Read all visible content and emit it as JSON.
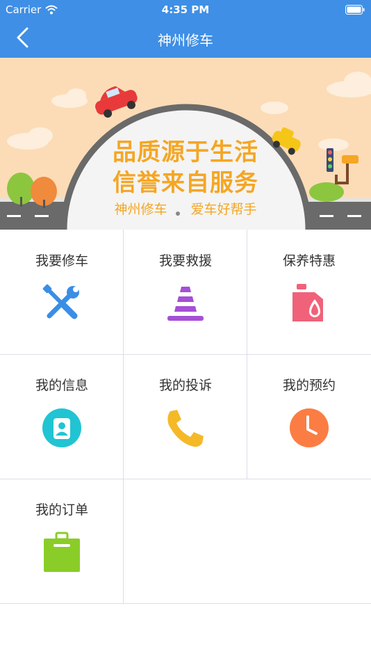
{
  "status_bar": {
    "carrier": "Carrier",
    "time": "4:35 PM"
  },
  "nav": {
    "title": "神州修车",
    "back_icon": "chevron-left-icon"
  },
  "banner": {
    "headline_1": "品质源于生活",
    "headline_2": "信誉来自服务",
    "tagline_1": "神州修车",
    "tagline_2": "爱车好帮手",
    "colors": {
      "sky": "#fcdcb6",
      "road": "#6a6a6a",
      "headline": "#f5a623",
      "tagline": "#f5a623"
    }
  },
  "menu": [
    {
      "label": "我要修车",
      "icon": "wrench-screwdriver-icon",
      "color": "#3a8ee6"
    },
    {
      "label": "我要救援",
      "icon": "traffic-cone-icon",
      "color": "#a54fd6"
    },
    {
      "label": "保养特惠",
      "icon": "oil-can-icon",
      "color": "#f0627a"
    },
    {
      "label": "我的信息",
      "icon": "user-profile-icon",
      "color": "#21c4d2"
    },
    {
      "label": "我的投诉",
      "icon": "phone-icon",
      "color": "#f5b928"
    },
    {
      "label": "我的预约",
      "icon": "clock-icon",
      "color": "#fb7d44"
    },
    {
      "label": "我的订单",
      "icon": "clipboard-icon",
      "color": "#8acd28"
    }
  ]
}
